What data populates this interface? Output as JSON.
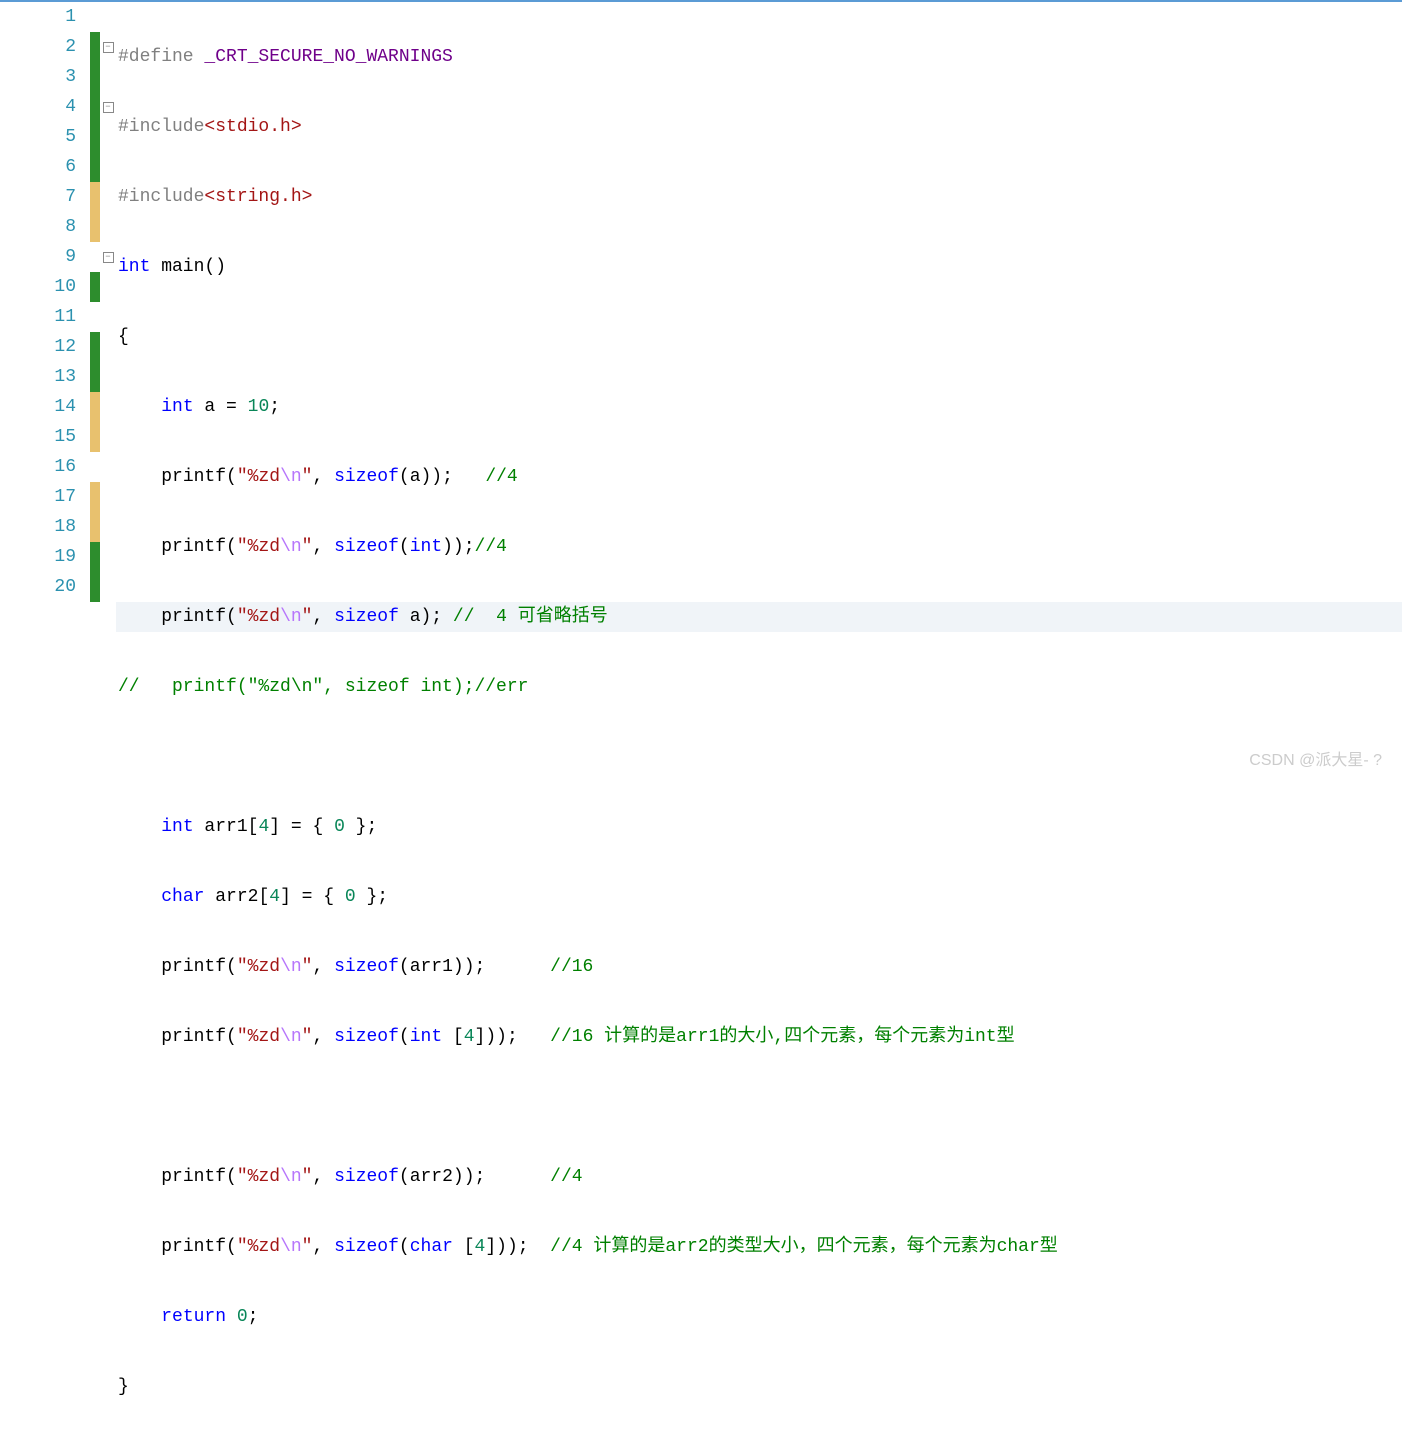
{
  "watermark": "CSDN @派大星- ?",
  "lines": [
    {
      "num": "1",
      "marker": "",
      "fold": "",
      "indent": false
    },
    {
      "num": "2",
      "marker": "green",
      "fold": "minus",
      "indent": false
    },
    {
      "num": "3",
      "marker": "green",
      "fold": "",
      "indent": true
    },
    {
      "num": "4",
      "marker": "green",
      "fold": "minus",
      "indent": false
    },
    {
      "num": "5",
      "marker": "green",
      "fold": "",
      "indent": true
    },
    {
      "num": "6",
      "marker": "green",
      "fold": "",
      "indent": true
    },
    {
      "num": "7",
      "marker": "yellow",
      "fold": "",
      "indent": true
    },
    {
      "num": "8",
      "marker": "yellow",
      "fold": "",
      "indent": true
    },
    {
      "num": "9",
      "marker": "",
      "fold": "minus",
      "indent": true,
      "highlight": true
    },
    {
      "num": "10",
      "marker": "green",
      "fold": "",
      "indent": true
    },
    {
      "num": "11",
      "marker": "",
      "fold": "",
      "indent": true
    },
    {
      "num": "12",
      "marker": "green",
      "fold": "",
      "indent": true
    },
    {
      "num": "13",
      "marker": "green",
      "fold": "",
      "indent": true
    },
    {
      "num": "14",
      "marker": "yellow",
      "fold": "",
      "indent": true
    },
    {
      "num": "15",
      "marker": "yellow",
      "fold": "",
      "indent": true
    },
    {
      "num": "16",
      "marker": "",
      "fold": "",
      "indent": true
    },
    {
      "num": "17",
      "marker": "yellow",
      "fold": "",
      "indent": true
    },
    {
      "num": "18",
      "marker": "yellow",
      "fold": "",
      "indent": true
    },
    {
      "num": "19",
      "marker": "green",
      "fold": "",
      "indent": true
    },
    {
      "num": "20",
      "marker": "green",
      "fold": "",
      "indent": true
    }
  ],
  "code": {
    "l1": {
      "pre": "#define ",
      "macro": "_CRT_SECURE_NO_WARNINGS"
    },
    "l2": {
      "pre": "#include",
      "hdr": "<stdio.h>"
    },
    "l3": {
      "pre": "#include",
      "hdr": "<string.h>"
    },
    "l4": {
      "kw1": "int",
      "txt": " main()"
    },
    "l5": {
      "txt": "{"
    },
    "l6": {
      "kw1": "int",
      "txt": " a = ",
      "num": "10",
      "end": ";"
    },
    "l7": {
      "fn": "printf(",
      "str": "\"%zd",
      "esc": "\\n",
      "str2": "\"",
      "mid": ", ",
      "kw": "sizeof",
      "end": "(a));   ",
      "cmt": "//4"
    },
    "l8": {
      "fn": "printf(",
      "str": "\"%zd",
      "esc": "\\n",
      "str2": "\"",
      "mid": ", ",
      "kw": "sizeof",
      "p": "(",
      "kw2": "int",
      "end": "));",
      "cmt": "//4"
    },
    "l9": {
      "fn": "printf(",
      "str": "\"%zd",
      "esc": "\\n",
      "str2": "\"",
      "mid": ", ",
      "kw": "sizeof",
      "end": " a); ",
      "cmt": "//  4 可省略括号"
    },
    "l10": {
      "cmt": "//   printf(\"%zd\\n\", sizeof int);//err"
    },
    "l12": {
      "kw1": "int",
      "txt": " arr1[",
      "num": "4",
      "mid": "] = { ",
      "num2": "0",
      "end": " };"
    },
    "l13": {
      "kw1": "char",
      "txt": " arr2[",
      "num": "4",
      "mid": "] = { ",
      "num2": "0",
      "end": " };"
    },
    "l14": {
      "fn": "printf(",
      "str": "\"%zd",
      "esc": "\\n",
      "str2": "\"",
      "mid": ", ",
      "kw": "sizeof",
      "end": "(arr1));      ",
      "cmt": "//16"
    },
    "l15": {
      "fn": "printf(",
      "str": "\"%zd",
      "esc": "\\n",
      "str2": "\"",
      "mid": ", ",
      "kw": "sizeof",
      "p": "(",
      "kw2": "int",
      "mid2": " [",
      "num": "4",
      "end": "]));   ",
      "cmt": "//16 计算的是arr1的大小,四个元素，每个元素为int型"
    },
    "l17": {
      "fn": "printf(",
      "str": "\"%zd",
      "esc": "\\n",
      "str2": "\"",
      "mid": ", ",
      "kw": "sizeof",
      "end": "(arr2));      ",
      "cmt": "//4"
    },
    "l18": {
      "fn": "printf(",
      "str": "\"%zd",
      "esc": "\\n",
      "str2": "\"",
      "mid": ", ",
      "kw": "sizeof",
      "p": "(",
      "kw2": "char",
      "mid2": " [",
      "num": "4",
      "end": "]));  ",
      "cmt": "//4 计算的是arr2的类型大小，四个元素，每个元素为char型"
    },
    "l19": {
      "kw1": "return",
      "txt": " ",
      "num": "0",
      "end": ";"
    },
    "l20": {
      "txt": "}"
    }
  }
}
